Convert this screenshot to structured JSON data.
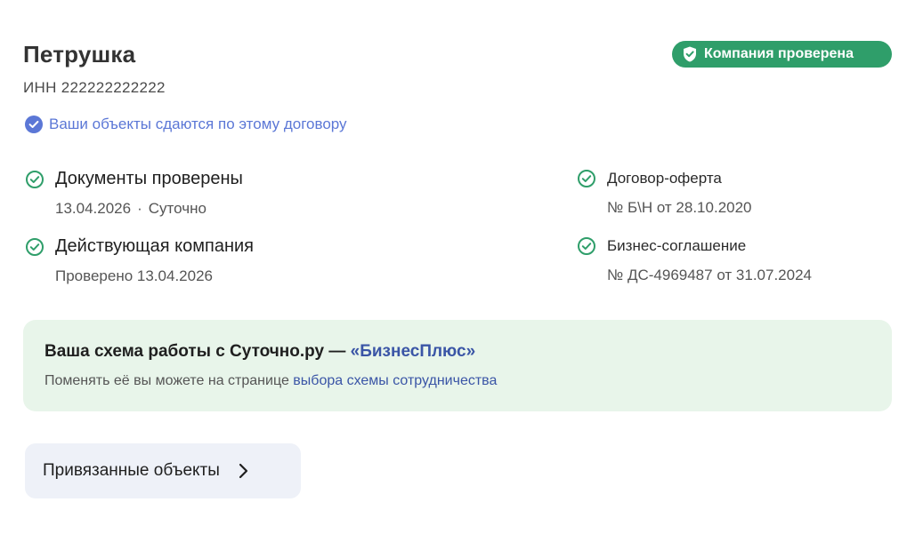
{
  "company": {
    "name": "Петрушка",
    "inn": "ИНН 222222222222",
    "verified_badge": "Компания проверена",
    "contract_note": "Ваши объекты сдаются по этому договору"
  },
  "checks": [
    {
      "title": "Документы проверены",
      "date": "13.04.2026",
      "source": "Суточно"
    },
    {
      "title": "Действующая компания",
      "subtitle": "Проверено 13.04.2026"
    }
  ],
  "contracts": [
    {
      "title": "Договор-оферта",
      "subtitle": "№ Б\\Н от 28.10.2020"
    },
    {
      "title": "Бизнес-соглашение",
      "subtitle": "№ ДС-4969487 от 31.07.2024"
    }
  ],
  "scheme": {
    "title_prefix": "Ваша схема работы с Суточно.ру — ",
    "title_accent": "«БизнесПлюс»",
    "text_prefix": "Поменять её вы можете на странице ",
    "text_link": "выбора схемы сотрудничества"
  },
  "linked_objects": {
    "label": "Привязанные объекты"
  },
  "colors": {
    "badge_green": "#2f9e6a",
    "check_green": "#2f9e6a",
    "link_blue": "#5b77d6",
    "accent_blue": "#3a55a6",
    "scheme_bg": "#e8f5ea",
    "button_bg": "#eef1f8"
  },
  "icons": {
    "badge": "shield-check-icon",
    "contract_note": "check-circle-filled-icon",
    "items": "check-circle-outline-icon",
    "button": "chevron-right-icon"
  }
}
